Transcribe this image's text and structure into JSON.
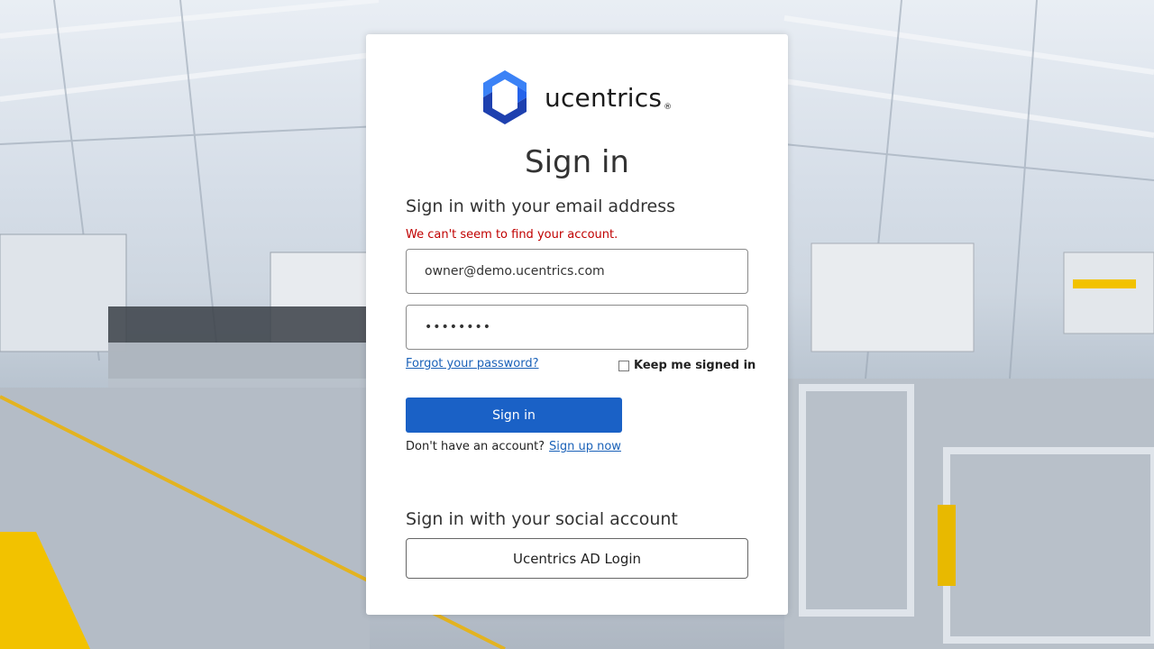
{
  "brand": {
    "name": "ucentrics",
    "registered_mark": "®",
    "colors": {
      "primary": "#1a61c6",
      "logo_light": "#3b82f6",
      "logo_dark": "#1e3a8a"
    }
  },
  "page": {
    "title": "Sign in",
    "subtitle": "Sign in with your email address",
    "error": "We can't seem to find your account."
  },
  "form": {
    "email_value": "owner@demo.ucentrics.com",
    "password_masked": "••••••••",
    "forgot_password": "Forgot your password?",
    "keep_signed_in": "Keep me signed in",
    "keep_signed_in_checked": false,
    "submit_label": "Sign in",
    "no_account_text": "Don't have an account?",
    "signup_link": "Sign up now"
  },
  "social": {
    "title": "Sign in with your social account",
    "ad_login_label": "Ucentrics AD Login"
  },
  "icons": {
    "logo": "ucentrics-logo-icon",
    "background": "factory-background-image"
  }
}
